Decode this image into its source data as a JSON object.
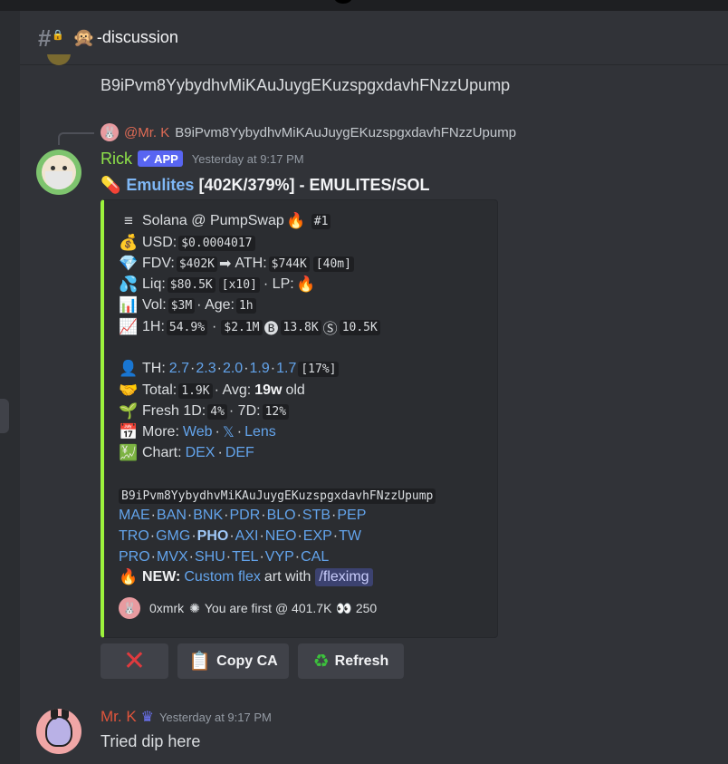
{
  "channel": {
    "emoji": "🙊",
    "name": "-discussion"
  },
  "previous_message": {
    "text": "B9iPvm8YybydhvMiKAuJuygEKuzspgxdavhFNzzUpump"
  },
  "reply": {
    "mention": "@Mr. K",
    "text": "B9iPvm8YybydhvMiKAuJuygEKuzspgxdavhFNzzUpump"
  },
  "bot_message": {
    "author": "Rick",
    "badge": "APP",
    "timestamp": "Yesterday at 9:17 PM",
    "title_icon": "💊",
    "title_link": "Emulites",
    "title_rest": "[402K/379%] - EMULITES/SOL",
    "embed": {
      "accent_color": "#9cf23c",
      "chain": {
        "label": "Solana @ PumpSwap",
        "rank": "#1"
      },
      "usd": {
        "label": "USD:",
        "value": "$0.0004017"
      },
      "fdv": {
        "label": "FDV:",
        "value": "$402K",
        "arrow": "➡",
        "ath_label": "ATH:",
        "ath_value": "$744K",
        "ath_age": "[40m]"
      },
      "liq": {
        "label": "Liq:",
        "value": "$80.5K",
        "mult": "[x10]",
        "lp_label": "· LP:"
      },
      "vol": {
        "label": "Vol:",
        "value": "$3M",
        "age_label": "· Age:",
        "age_value": "1h"
      },
      "change": {
        "label": "1H:",
        "pct": "54.9%",
        "vol": "$2.1M",
        "buy_icon": "🅑",
        "buys": "13.8K",
        "sell_icon": "Ⓢ",
        "sells": "10.5K"
      },
      "th": {
        "label": "TH:",
        "links": [
          "2.7",
          "2.3",
          "2.0",
          "1.9",
          "1.7"
        ],
        "total": "[17%]"
      },
      "holders": {
        "label": "Total:",
        "value": "1.9K",
        "avg_label": "· Avg:",
        "avg_value": "19w",
        "avg_suffix": "old"
      },
      "fresh": {
        "label": "Fresh 1D:",
        "d1": "4%",
        "d7_label": "· 7D:",
        "d7": "12%"
      },
      "more": {
        "label": "More:",
        "links": [
          "Web",
          "𝕏",
          "Lens"
        ]
      },
      "chart": {
        "label": "Chart:",
        "links": [
          "DEX",
          "DEF"
        ]
      },
      "contract": "B9iPvm8YybydhvMiKAuJuygEKuzspgxdavhFNzzUpump",
      "bots_row1": [
        "MAE",
        "BAN",
        "BNK",
        "PDR",
        "BLO",
        "STB",
        "PEP"
      ],
      "bots_row2": [
        "TRO",
        "GMG",
        "PHO",
        "AXI",
        "NEO",
        "EXP",
        "TW"
      ],
      "bots_row3": [
        "PRO",
        "MVX",
        "SHU",
        "TEL",
        "VYP",
        "CAL"
      ],
      "new_line": {
        "label": "NEW:",
        "link": "Custom flex",
        "middle": "art with",
        "command": "/fleximg"
      },
      "footer": {
        "user": "0xmrk",
        "text": "You are first @ 401.7K",
        "views": "250"
      }
    }
  },
  "buttons": {
    "dismiss": "✕",
    "copy": "Copy CA",
    "refresh": "Refresh"
  },
  "user_message": {
    "author": "Mr. K",
    "timestamp": "Yesterday at 9:17 PM",
    "text": "Tried dip here"
  }
}
